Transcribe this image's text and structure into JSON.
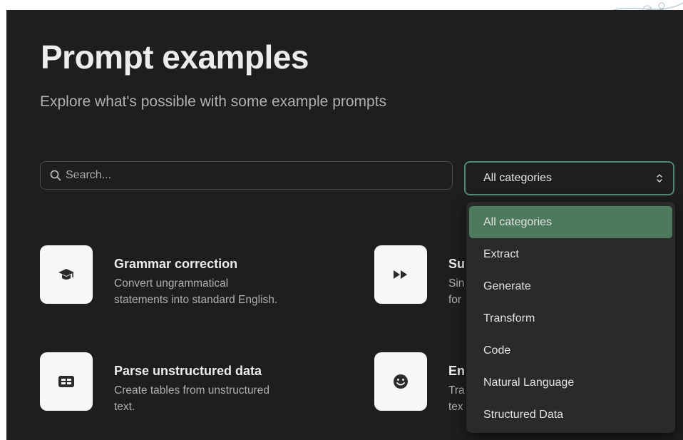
{
  "header": {
    "title": "Prompt examples",
    "subtitle": "Explore what's possible with some example prompts"
  },
  "search": {
    "placeholder": "Search...",
    "icon": "search-icon"
  },
  "category_select": {
    "value": "All categories",
    "icon": "updown-chevron-icon",
    "options": [
      "All categories",
      "Extract",
      "Generate",
      "Transform",
      "Code",
      "Natural Language",
      "Structured Data"
    ],
    "selected_index": 0
  },
  "cards": [
    {
      "icon": "graduation-cap-icon",
      "title": "Grammar correction",
      "desc_line1": "Convert ungrammatical",
      "desc_line2": "statements into standard English."
    },
    {
      "icon": "fast-forward-icon",
      "title": "Su",
      "desc_line1": "Sin",
      "desc_line2": "for"
    },
    {
      "icon": "table-icon",
      "title": "Parse unstructured data",
      "desc_line1": "Create tables from unstructured",
      "desc_line2": "text."
    },
    {
      "icon": "smiley-icon",
      "title": "En",
      "desc_line1": "Tra",
      "desc_line2": "tex"
    }
  ],
  "colors": {
    "panel_bg": "#1e1e1e",
    "accent_green": "#4d7a5c",
    "select_border": "#4f8a6e",
    "dropdown_bg": "#2a2a2a",
    "card_icon_bg": "#f7f7f7"
  }
}
